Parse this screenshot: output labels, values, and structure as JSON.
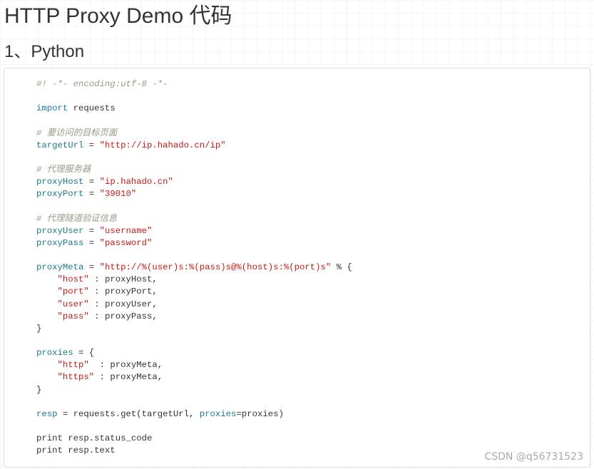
{
  "page_title": "HTTP Proxy Demo 代码",
  "section_heading": "1、Python",
  "code_language": "python",
  "code_lines": [
    [
      {
        "t": "#! -*- encoding:utf-8 -*-",
        "k": "c"
      }
    ],
    [],
    [
      {
        "t": "import",
        "k": "k"
      },
      {
        "t": " requests",
        "k": "p"
      }
    ],
    [],
    [
      {
        "t": "# 要访问的目标页面",
        "k": "c"
      }
    ],
    [
      {
        "t": "targetUrl",
        "k": "v"
      },
      {
        "t": " = ",
        "k": "p"
      },
      {
        "t": "\"http://ip.hahado.cn/ip\"",
        "k": "s"
      }
    ],
    [],
    [
      {
        "t": "# 代理服务器",
        "k": "c"
      }
    ],
    [
      {
        "t": "proxyHost",
        "k": "v"
      },
      {
        "t": " = ",
        "k": "p"
      },
      {
        "t": "\"ip.hahado.cn\"",
        "k": "s"
      }
    ],
    [
      {
        "t": "proxyPort",
        "k": "v"
      },
      {
        "t": " = ",
        "k": "p"
      },
      {
        "t": "\"39010\"",
        "k": "s"
      }
    ],
    [],
    [
      {
        "t": "# 代理隧道验证信息",
        "k": "c"
      }
    ],
    [
      {
        "t": "proxyUser",
        "k": "v"
      },
      {
        "t": " = ",
        "k": "p"
      },
      {
        "t": "\"username\"",
        "k": "s"
      }
    ],
    [
      {
        "t": "proxyPass",
        "k": "v"
      },
      {
        "t": " = ",
        "k": "p"
      },
      {
        "t": "\"password\"",
        "k": "s"
      }
    ],
    [],
    [
      {
        "t": "proxyMeta",
        "k": "v"
      },
      {
        "t": " = ",
        "k": "p"
      },
      {
        "t": "\"http://%(user)s:%(pass)s@%(host)s:%(port)s\"",
        "k": "s"
      },
      {
        "t": " % {",
        "k": "p"
      }
    ],
    [
      {
        "t": "    ",
        "k": "p"
      },
      {
        "t": "\"host\"",
        "k": "s"
      },
      {
        "t": " : proxyHost,",
        "k": "p"
      }
    ],
    [
      {
        "t": "    ",
        "k": "p"
      },
      {
        "t": "\"port\"",
        "k": "s"
      },
      {
        "t": " : proxyPort,",
        "k": "p"
      }
    ],
    [
      {
        "t": "    ",
        "k": "p"
      },
      {
        "t": "\"user\"",
        "k": "s"
      },
      {
        "t": " : proxyUser,",
        "k": "p"
      }
    ],
    [
      {
        "t": "    ",
        "k": "p"
      },
      {
        "t": "\"pass\"",
        "k": "s"
      },
      {
        "t": " : proxyPass,",
        "k": "p"
      }
    ],
    [
      {
        "t": "}",
        "k": "p"
      }
    ],
    [],
    [
      {
        "t": "proxies",
        "k": "v"
      },
      {
        "t": " = {",
        "k": "p"
      }
    ],
    [
      {
        "t": "    ",
        "k": "p"
      },
      {
        "t": "\"http\"",
        "k": "s"
      },
      {
        "t": "  : proxyMeta,",
        "k": "p"
      }
    ],
    [
      {
        "t": "    ",
        "k": "p"
      },
      {
        "t": "\"https\"",
        "k": "s"
      },
      {
        "t": " : proxyMeta,",
        "k": "p"
      }
    ],
    [
      {
        "t": "}",
        "k": "p"
      }
    ],
    [],
    [
      {
        "t": "resp",
        "k": "v"
      },
      {
        "t": " = requests.get(targetUrl, ",
        "k": "p"
      },
      {
        "t": "proxies",
        "k": "v"
      },
      {
        "t": "=proxies)",
        "k": "p"
      }
    ],
    [],
    [
      {
        "t": "print resp.status_code",
        "k": "p"
      }
    ],
    [
      {
        "t": "print resp.text",
        "k": "p"
      }
    ]
  ],
  "watermark": "CSDN @q56731523"
}
